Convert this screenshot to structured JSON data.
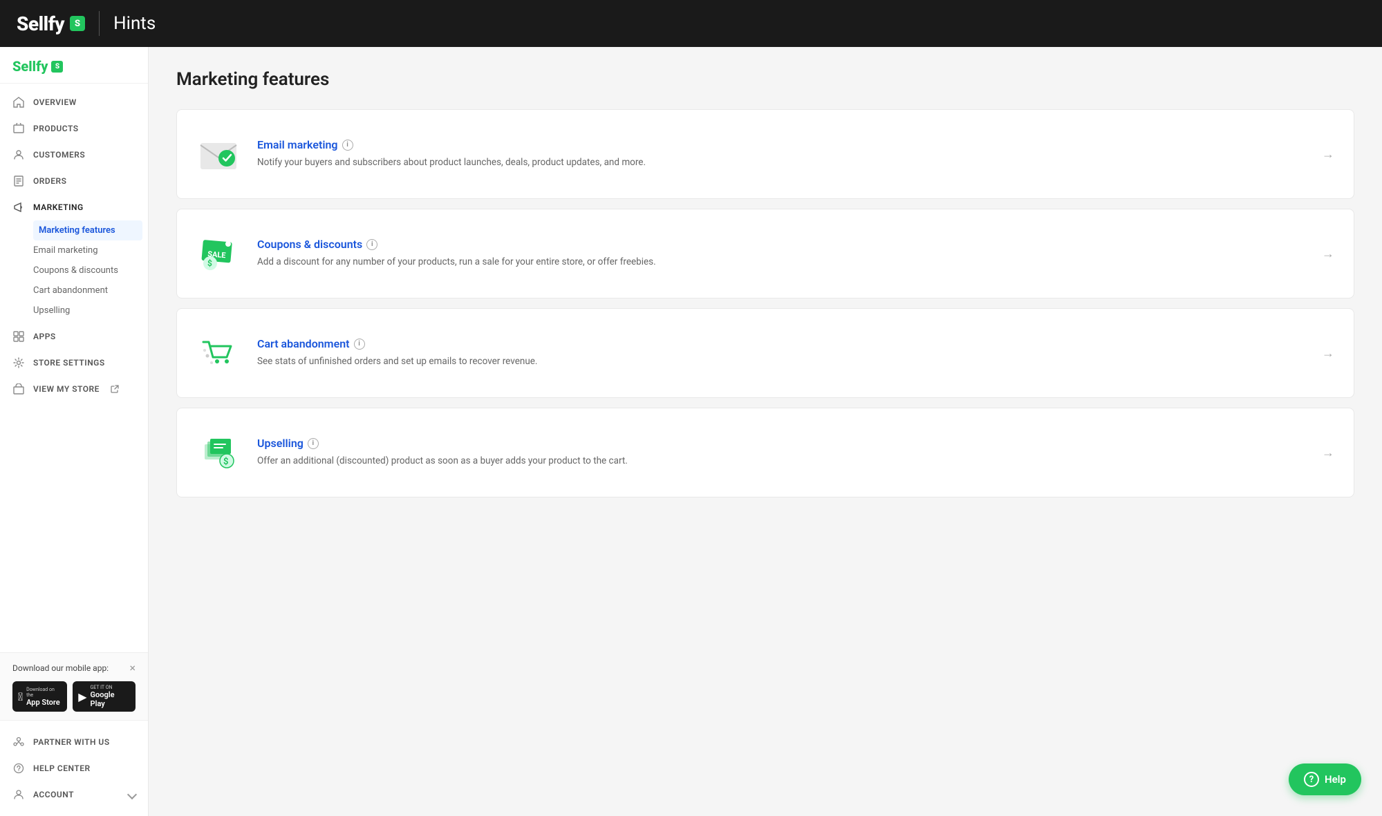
{
  "topbar": {
    "logo": "Sellfy",
    "logo_badge": "S",
    "title": "Hints"
  },
  "sidebar": {
    "logo": "Sellfy",
    "logo_badge": "S",
    "nav_items": [
      {
        "id": "overview",
        "label": "OVERVIEW",
        "icon": "home"
      },
      {
        "id": "products",
        "label": "PRODUCTS",
        "icon": "products"
      },
      {
        "id": "customers",
        "label": "CUSTOMERS",
        "icon": "customers"
      },
      {
        "id": "orders",
        "label": "ORDERS",
        "icon": "orders"
      },
      {
        "id": "marketing",
        "label": "MARKETING",
        "icon": "marketing",
        "active": true,
        "subnav": [
          {
            "id": "marketing-features",
            "label": "Marketing features",
            "active": true
          },
          {
            "id": "email-marketing",
            "label": "Email marketing"
          },
          {
            "id": "coupons-discounts",
            "label": "Coupons & discounts"
          },
          {
            "id": "cart-abandonment",
            "label": "Cart abandonment"
          },
          {
            "id": "upselling",
            "label": "Upselling"
          }
        ]
      },
      {
        "id": "apps",
        "label": "APPS",
        "icon": "apps"
      },
      {
        "id": "store-settings",
        "label": "STORE SETTINGS",
        "icon": "settings"
      },
      {
        "id": "view-my-store",
        "label": "VIEW MY STORE",
        "icon": "external"
      }
    ],
    "bottom_nav": [
      {
        "id": "partner-with-us",
        "label": "PARTNER WITH US",
        "icon": "partner"
      },
      {
        "id": "help-center",
        "label": "HELP CENTER",
        "icon": "help"
      },
      {
        "id": "account",
        "label": "ACCOUNT",
        "icon": "account"
      }
    ],
    "app_download": {
      "title": "Download our mobile app:",
      "app_store_label1": "Download on the",
      "app_store_label2": "App Store",
      "google_play_label1": "GET IT ON",
      "google_play_label2": "Google Play"
    }
  },
  "main": {
    "page_title": "Marketing features",
    "cards": [
      {
        "id": "email-marketing",
        "title": "Email marketing",
        "description": "Notify your buyers and subscribers about product launches, deals, product updates, and more.",
        "icon_type": "email"
      },
      {
        "id": "coupons-discounts",
        "title": "Coupons & discounts",
        "description": "Add a discount for any number of your products, run a sale for your entire store, or offer freebies.",
        "icon_type": "coupon"
      },
      {
        "id": "cart-abandonment",
        "title": "Cart abandonment",
        "description": "See stats of unfinished orders and set up emails to recover revenue.",
        "icon_type": "cart"
      },
      {
        "id": "upselling",
        "title": "Upselling",
        "description": "Offer an additional (discounted) product as soon as a buyer adds your product to the cart.",
        "icon_type": "upsell"
      }
    ]
  },
  "help_button": {
    "label": "Help"
  }
}
